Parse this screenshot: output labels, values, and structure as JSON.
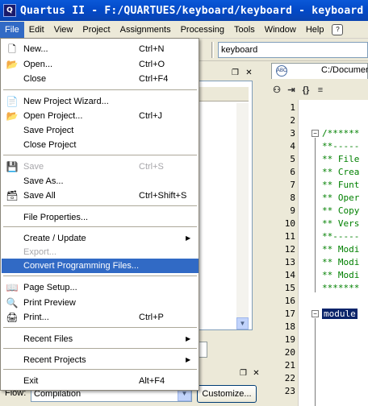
{
  "window": {
    "title": "Quartus II - F:/QUARTUES/keyboard/keyboard - keyboard",
    "app_icon_text": "Q"
  },
  "menubar": {
    "items": [
      "File",
      "Edit",
      "View",
      "Project",
      "Assignments",
      "Processing",
      "Tools",
      "Window",
      "Help"
    ],
    "active": "File"
  },
  "toolbar": {
    "project_combo_value": "keyboard"
  },
  "editor": {
    "tab_label": "C:/Documen",
    "tab_icon_text": "ABC",
    "toolbar_icons": [
      "binoculars-icon",
      "indent-icon",
      "braces-icon",
      "align-icon"
    ],
    "line_numbers": [
      "1",
      "2",
      "3",
      "4",
      "5",
      "6",
      "7",
      "8",
      "9",
      "10",
      "11",
      "12",
      "13",
      "14",
      "15",
      "16",
      "17",
      "18",
      "19",
      "20",
      "21",
      "22",
      "23"
    ],
    "code_lines": {
      "l3": "/******",
      "l4": "**-----",
      "l5": "** File",
      "l6": "** Crea",
      "l7": "** Funt",
      "l8": "** Oper",
      "l9": "** Copy",
      "l10": "** Vers",
      "l11": "**-----",
      "l12": "** Modi",
      "l13": "** Modi",
      "l14": "** Modi",
      "l15": "*******",
      "l17": "module"
    }
  },
  "flow_panel": {
    "label": "Flow:",
    "combo_value": "Compilation",
    "customize_label": "Customize..."
  },
  "file_menu": {
    "new": {
      "label": "New...",
      "shortcut": "Ctrl+N"
    },
    "open": {
      "label": "Open...",
      "shortcut": "Ctrl+O"
    },
    "close": {
      "label": "Close",
      "shortcut": "Ctrl+F4"
    },
    "new_project_wizard": {
      "label": "New Project Wizard..."
    },
    "open_project": {
      "label": "Open Project...",
      "shortcut": "Ctrl+J"
    },
    "save_project": {
      "label": "Save Project"
    },
    "close_project": {
      "label": "Close Project"
    },
    "save": {
      "label": "Save",
      "shortcut": "Ctrl+S"
    },
    "save_as": {
      "label": "Save As..."
    },
    "save_all": {
      "label": "Save All",
      "shortcut": "Ctrl+Shift+S"
    },
    "file_properties": {
      "label": "File Properties..."
    },
    "create_update": {
      "label": "Create / Update"
    },
    "export": {
      "label": "Export..."
    },
    "convert_programming_files": {
      "label": "Convert Programming Files..."
    },
    "page_setup": {
      "label": "Page Setup..."
    },
    "print_preview": {
      "label": "Print Preview"
    },
    "print": {
      "label": "Print...",
      "shortcut": "Ctrl+P"
    },
    "recent_files": {
      "label": "Recent Files"
    },
    "recent_projects": {
      "label": "Recent Projects"
    },
    "exit": {
      "label": "Exit",
      "shortcut": "Alt+F4"
    }
  },
  "colors": {
    "titlebar": "#0349c7",
    "highlight": "#316ac5",
    "comment": "#008000"
  }
}
